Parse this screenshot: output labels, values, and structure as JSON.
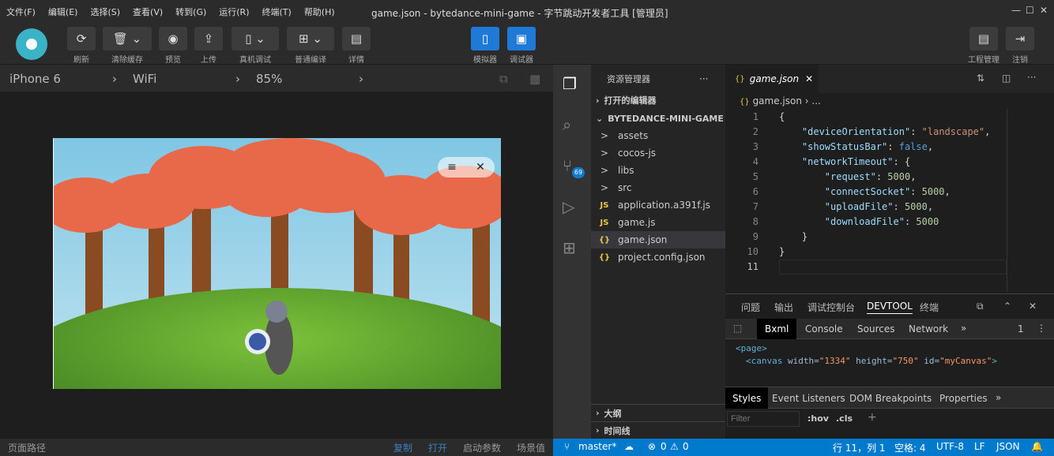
{
  "menu": [
    "文件(F)",
    "编辑(E)",
    "选择(S)",
    "查看(V)",
    "转到(G)",
    "运行(R)",
    "终端(T)",
    "帮助(H)"
  ],
  "window_title": "game.json - bytedance-mini-game - 字节跳动开发者工具 [管理员]",
  "toolbar": {
    "refresh": "刷新",
    "clear_cache": "清除缓存",
    "preview": "预览",
    "upload": "上传",
    "device_debug": "真机调试",
    "compile": "普通编译",
    "details": "详情",
    "simulator": "模拟器",
    "debugger": "调试器",
    "project": "工程管理",
    "logout": "注销"
  },
  "device": {
    "model": "iPhone 6",
    "network": "WiFi",
    "zoom": "85%"
  },
  "sim_status": {
    "path": "页面路径",
    "copy": "复制",
    "open": "打开",
    "params": "启动参数",
    "scene": "场景值"
  },
  "explorer": {
    "title": "资源管理器",
    "open_editors": "打开的编辑器",
    "project": "BYTEDANCE-MINI-GAME",
    "items": [
      {
        "icon": ">",
        "name": "assets"
      },
      {
        "icon": ">",
        "name": "cocos-js"
      },
      {
        "icon": ">",
        "name": "libs"
      },
      {
        "icon": ">",
        "name": "src"
      },
      {
        "icon": "JS",
        "name": "application.a391f.js"
      },
      {
        "icon": "JS",
        "name": "game.js"
      },
      {
        "icon": "{}",
        "name": "game.json"
      },
      {
        "icon": "{}",
        "name": "project.config.json"
      }
    ],
    "outline": "大纲",
    "timeline": "时间线"
  },
  "scm_badge": "69",
  "editor": {
    "tab": "game.json",
    "breadcrumb_file": "game.json",
    "breadcrumb_more": "...",
    "lines": [
      "1",
      "2",
      "3",
      "4",
      "5",
      "6",
      "7",
      "8",
      "9",
      "10",
      "11"
    ],
    "code": {
      "l1": "{",
      "l2k": "\"deviceOrientation\"",
      "l2v": "\"landscape\"",
      "l3k": "\"showStatusBar\"",
      "l3v": "false",
      "l4k": "\"networkTimeout\"",
      "l5k": "\"request\"",
      "l5v": "5000",
      "l6k": "\"connectSocket\"",
      "l6v": "5000",
      "l7k": "\"uploadFile\"",
      "l7v": "5000",
      "l8k": "\"downloadFile\"",
      "l8v": "5000",
      "l9": "}",
      "l10": "}"
    }
  },
  "panel": {
    "tabs": [
      "问题",
      "输出",
      "调试控制台",
      "DEVTOOL",
      "终端"
    ],
    "devtabs": [
      "Bxml",
      "Console",
      "Sources",
      "Network"
    ],
    "count": "1",
    "xml1": "<page>",
    "xml2_tag": "<canvas ",
    "xml2_w": "width=",
    "xml2_wv": "\"1334\"",
    "xml2_h": " height=",
    "xml2_hv": "\"750\"",
    "xml2_id": " id=",
    "xml2_idv": "\"myCanvas\"",
    "xml2_end": ">",
    "styletabs": [
      "Styles",
      "Event Listeners",
      "DOM Breakpoints",
      "Properties"
    ],
    "filter": "Filter",
    "hov": ":hov",
    "cls": ".cls"
  },
  "status": {
    "branch": "master*",
    "errors": "0",
    "warnings": "0",
    "pos": "行 11，列 1",
    "spaces": "空格: 4",
    "enc": "UTF-8",
    "eol": "LF",
    "lang": "JSON"
  }
}
